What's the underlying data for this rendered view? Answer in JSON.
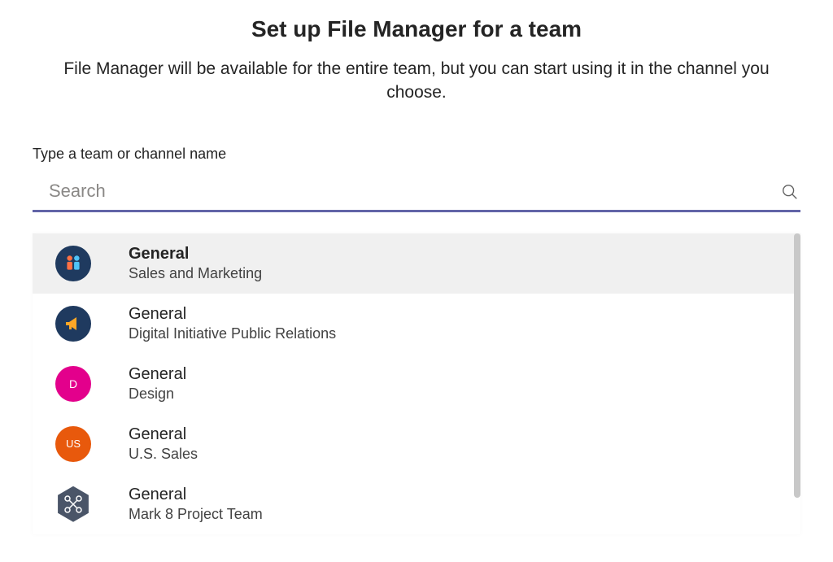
{
  "header": {
    "title": "Set up File Manager for a team",
    "subtitle": "File Manager will be available for the entire team, but you can start using it in the channel you choose."
  },
  "search": {
    "label": "Type a team or channel name",
    "placeholder": "Search",
    "value": ""
  },
  "results": [
    {
      "channel": "General",
      "team": "Sales and Marketing",
      "avatar_type": "people",
      "avatar_text": "",
      "selected": true
    },
    {
      "channel": "General",
      "team": "Digital Initiative Public Relations",
      "avatar_type": "megaphone",
      "avatar_text": "",
      "selected": false
    },
    {
      "channel": "General",
      "team": "Design",
      "avatar_type": "letter-d",
      "avatar_text": "D",
      "selected": false
    },
    {
      "channel": "General",
      "team": "U.S. Sales",
      "avatar_type": "letter-us",
      "avatar_text": "US",
      "selected": false
    },
    {
      "channel": "General",
      "team": "Mark 8 Project Team",
      "avatar_type": "hex",
      "avatar_text": "",
      "selected": false
    }
  ]
}
